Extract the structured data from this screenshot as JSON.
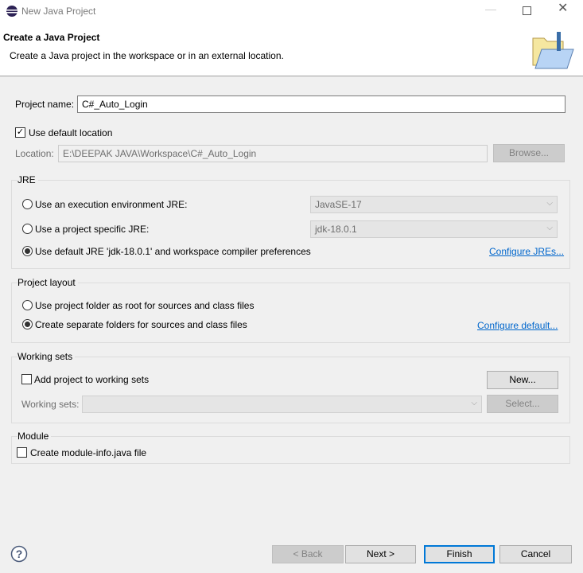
{
  "window": {
    "title": "New Java Project"
  },
  "header": {
    "title": "Create a Java Project",
    "description": "Create a Java project in the workspace or in an external location."
  },
  "project": {
    "name_label": "Project name:",
    "name_value": "C#_Auto_Login",
    "use_default_location_label": "Use default location",
    "use_default_location_checked": true,
    "location_label": "Location:",
    "location_value": "E:\\DEEPAK JAVA\\Workspace\\C#_Auto_Login",
    "browse_label": "Browse..."
  },
  "jre": {
    "group_label": "JRE",
    "options": [
      {
        "label": "Use an execution environment JRE:",
        "selected": false,
        "combo": "JavaSE-17"
      },
      {
        "label": "Use a project specific JRE:",
        "selected": false,
        "combo": "jdk-18.0.1"
      },
      {
        "label": "Use default JRE 'jdk-18.0.1' and workspace compiler preferences",
        "selected": true
      }
    ],
    "configure_link": "Configure JREs..."
  },
  "layout": {
    "group_label": "Project layout",
    "options": [
      {
        "label": "Use project folder as root for sources and class files",
        "selected": false
      },
      {
        "label": "Create separate folders for sources and class files",
        "selected": true
      }
    ],
    "configure_link": "Configure default..."
  },
  "working_sets": {
    "group_label": "Working sets",
    "add_label": "Add project to working sets",
    "add_checked": false,
    "new_button": "New...",
    "sets_label": "Working sets:",
    "sets_value": "",
    "select_button": "Select..."
  },
  "module": {
    "group_label": "Module",
    "create_label": "Create module-info.java file",
    "create_checked": false
  },
  "footer": {
    "back": "< Back",
    "next": "Next >",
    "finish": "Finish",
    "cancel": "Cancel"
  }
}
